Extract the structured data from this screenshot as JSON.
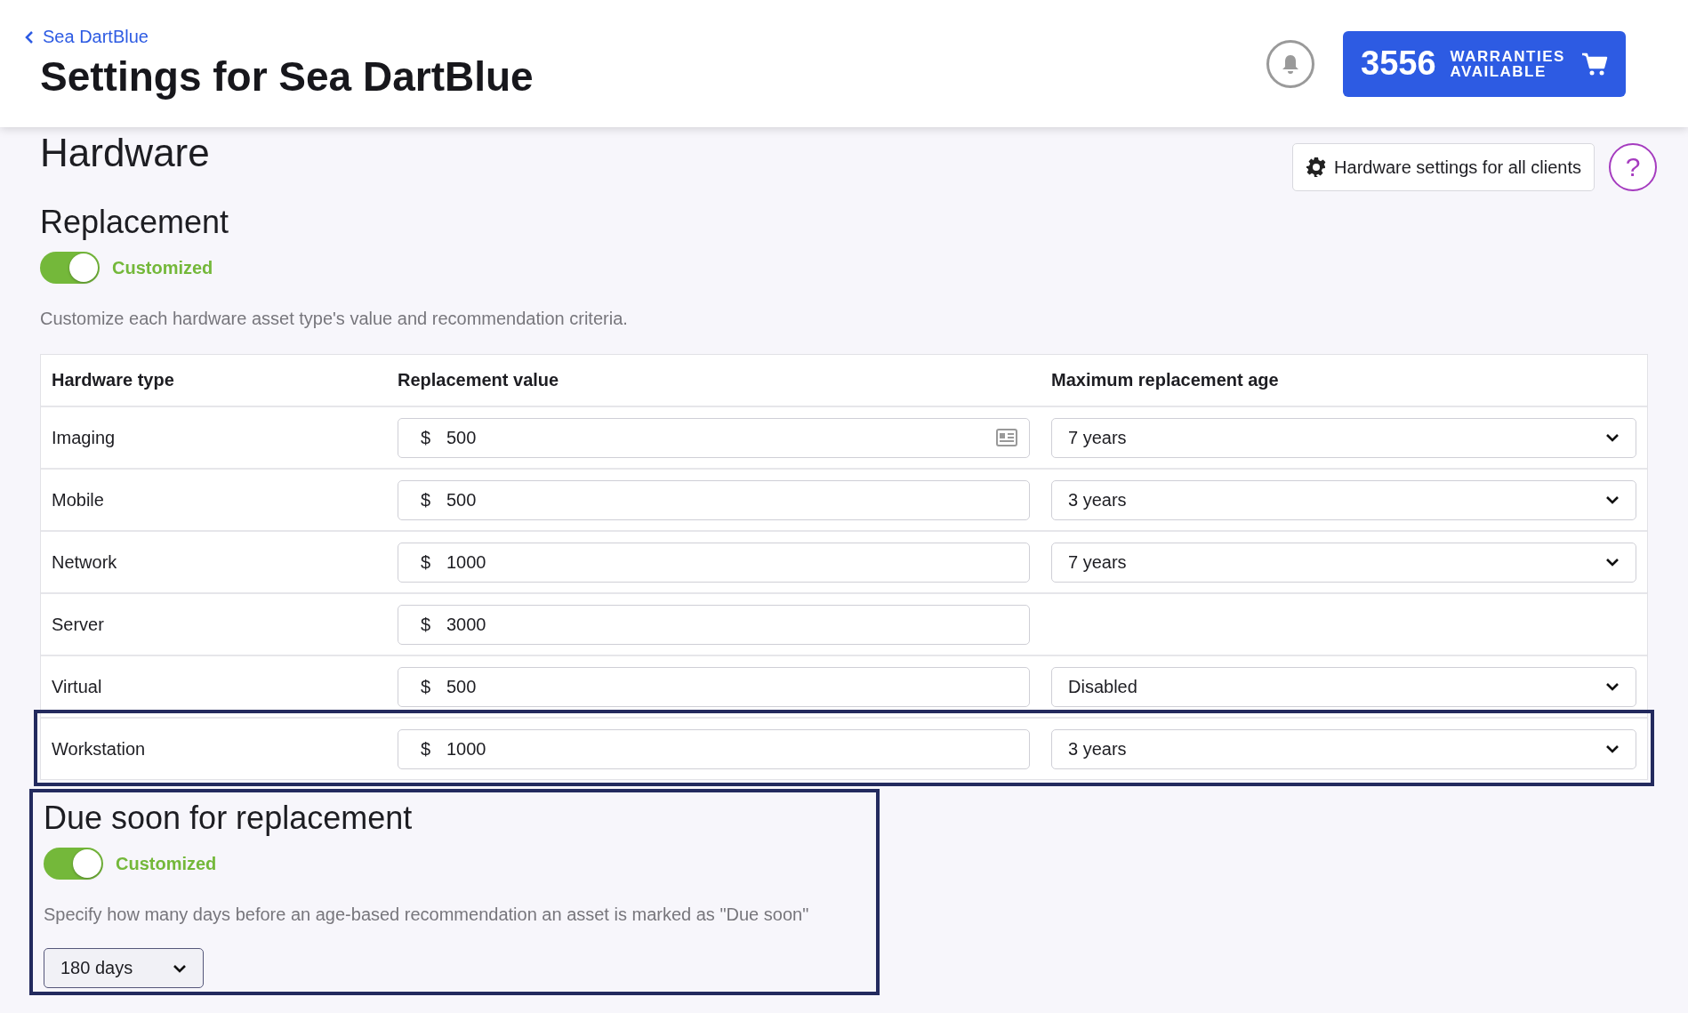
{
  "header": {
    "breadcrumb": "Sea DartBlue",
    "title": "Settings for Sea DartBlue",
    "warranties": {
      "count": "3556",
      "label_line_1": "WARRANTIES",
      "label_line_2": "AVAILABLE"
    }
  },
  "section": {
    "title": "Hardware",
    "all_clients_button": "Hardware settings for all clients",
    "help_button": "?"
  },
  "replacement": {
    "title": "Replacement",
    "toggle": {
      "on": true,
      "label": "Customized"
    },
    "description": "Customize each hardware asset type's value and recommendation criteria.",
    "table": {
      "columns": [
        "Hardware type",
        "Replacement value",
        "Maximum replacement age"
      ],
      "rows": [
        {
          "type": "Imaging",
          "currency": "$",
          "value": "500",
          "card_icon": true,
          "age": "7 years",
          "highlighted": false
        },
        {
          "type": "Mobile",
          "currency": "$",
          "value": "500",
          "card_icon": false,
          "age": "3 years",
          "highlighted": false
        },
        {
          "type": "Network",
          "currency": "$",
          "value": "1000",
          "card_icon": false,
          "age": "7 years",
          "highlighted": false
        },
        {
          "type": "Server",
          "currency": "$",
          "value": "3000",
          "card_icon": false,
          "highlighted": false
        },
        {
          "type": "Virtual",
          "currency": "$",
          "value": "500",
          "card_icon": false,
          "age": "Disabled",
          "highlighted": false
        },
        {
          "type": "Workstation",
          "currency": "$",
          "value": "1000",
          "card_icon": false,
          "age": "3 years",
          "highlighted": true
        }
      ]
    }
  },
  "due_soon": {
    "title": "Due soon for replacement",
    "highlighted": true,
    "toggle": {
      "on": true,
      "label": "Customized"
    },
    "description": "Specify how many days before an age-based recommendation an asset is marked as \"Due soon\"",
    "select": "180 days"
  }
}
